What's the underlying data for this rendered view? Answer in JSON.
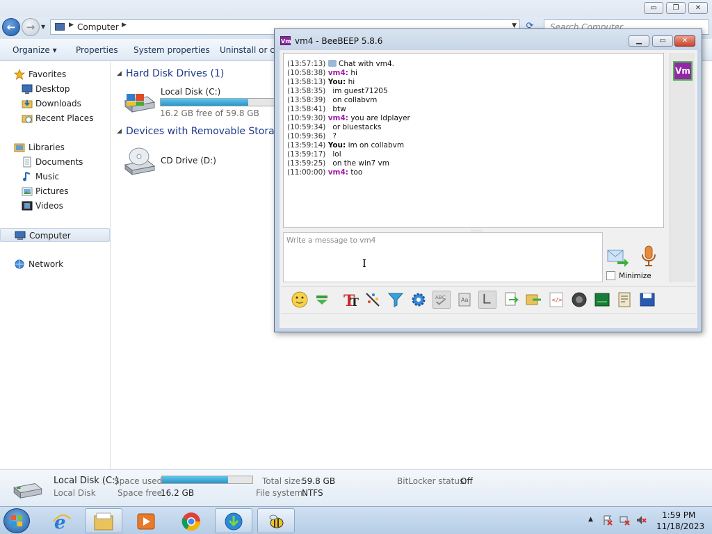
{
  "explorer": {
    "title_buttons": {
      "minimize": "▭",
      "maximize": "❐",
      "close": "✕"
    },
    "address": {
      "path": "Computer"
    },
    "search": {
      "placeholder": "Search Computer"
    },
    "toolbar": {
      "organize": "Organize ▾",
      "properties": "Properties",
      "system_properties": "System properties",
      "uninstall": "Uninstall or cha"
    },
    "nav": {
      "favorites": "Favorites",
      "desktop": "Desktop",
      "downloads": "Downloads",
      "recent_places": "Recent Places",
      "libraries": "Libraries",
      "documents": "Documents",
      "music": "Music",
      "pictures": "Pictures",
      "videos": "Videos",
      "computer": "Computer",
      "network": "Network"
    },
    "groups": {
      "hard_disks": "Hard Disk Drives (1)",
      "removable": "Devices with Removable Storage"
    },
    "drives": {
      "c": {
        "name": "Local Disk (C:)",
        "free_text": "16.2 GB free of 59.8 GB",
        "used_fraction": 0.73
      },
      "d": {
        "name": "CD Drive (D:)"
      }
    },
    "details": {
      "name": "Local Disk (C:)",
      "type": "Local Disk",
      "space_used_label": "Space used:",
      "space_free_label": "Space free:",
      "space_free": "16.2 GB",
      "total_size_label": "Total size:",
      "total_size": "59.8 GB",
      "file_system_label": "File system:",
      "file_system": "NTFS",
      "bitlocker_label": "BitLocker status:",
      "bitlocker": "Off",
      "used_fraction": 0.73
    }
  },
  "beebeep": {
    "title": "vm4 - BeeBEEP 5.8.6",
    "logo": "Vm",
    "avatar": "Vm",
    "messages": [
      {
        "ts": "(13:57:13)",
        "who": "",
        "text": "Chat with vm4."
      },
      {
        "ts": "(10:58:38)",
        "who": "vm4:",
        "text": " hi"
      },
      {
        "ts": "(13:58:13)",
        "who": "You:",
        "text": " hi"
      },
      {
        "ts": "(13:58:35)",
        "who": "",
        "text": "im guest71205"
      },
      {
        "ts": "(13:58:39)",
        "who": "",
        "text": "on collabvm"
      },
      {
        "ts": "(13:58:41)",
        "who": "",
        "text": "btw"
      },
      {
        "ts": "(10:59:30)",
        "who": "vm4:",
        "text": " you are ldplayer"
      },
      {
        "ts": "(10:59:34)",
        "who": "",
        "text": "or bluestacks"
      },
      {
        "ts": "(10:59:36)",
        "who": "",
        "text": "?"
      },
      {
        "ts": "(13:59:14)",
        "who": "You:",
        "text": " im on collabvm"
      },
      {
        "ts": "(13:59:17)",
        "who": "",
        "text": "lol"
      },
      {
        "ts": "(13:59:25)",
        "who": "",
        "text": "on the win7 vm"
      },
      {
        "ts": "(11:00:00)",
        "who": "vm4:",
        "text": " too"
      }
    ],
    "input_placeholder": "Write a message to vm4",
    "minimize_label": "Minimize"
  },
  "taskbar": {
    "time": "1:59 PM",
    "date": "11/18/2023"
  },
  "colors": {
    "accent": "#1e3a8a",
    "vm4": "#a01ea8",
    "avatar_bg": "#9327a8",
    "avatar_border": "#4fb34f"
  }
}
